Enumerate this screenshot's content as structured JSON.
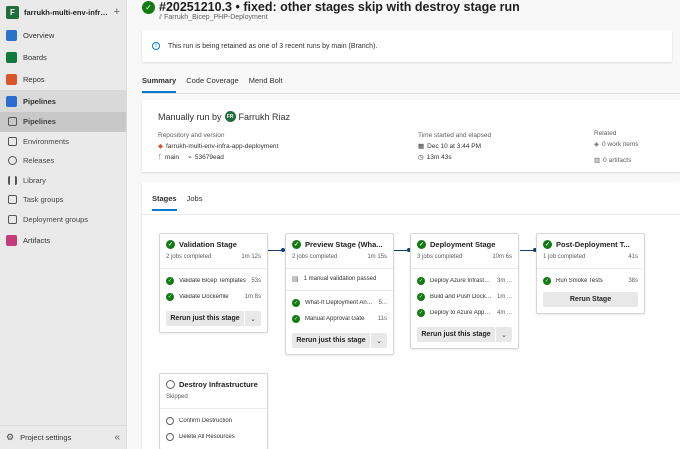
{
  "project": {
    "badge": "F",
    "name": "farrukh-multi-env-infra...",
    "plus": "+"
  },
  "nav": {
    "overview": "Overview",
    "boards": "Boards",
    "repos": "Repos",
    "pipelines_group": "Pipelines",
    "pipelines": "Pipelines",
    "environments": "Environments",
    "releases": "Releases",
    "library": "Library",
    "task_groups": "Task groups",
    "deployment_groups": "Deployment groups",
    "artifacts": "Artifacts",
    "project_settings": "Project settings",
    "collapse": "«"
  },
  "run": {
    "title": "#20251210.3 • fixed: other stages skip with destroy stage run",
    "pipeline": "Farrukh_Bicep_PHP-Deployment",
    "retention": "This run is being retained as one of 3 recent runs by main (Branch)."
  },
  "tabs": [
    "Summary",
    "Code Coverage",
    "Mend Bolt"
  ],
  "summary": {
    "trigger_prefix": "Manually run by",
    "user": "Farrukh Riaz",
    "user_initials": "FR",
    "repo_label": "Repository and version",
    "repo": "farrukh-multi-env-infra-app-deployment",
    "branch": "main",
    "commit": "53679ead",
    "time_label": "Time started and elapsed",
    "started": "Dec 10 at 3:44 PM",
    "elapsed": "13m 43s",
    "related_label": "Related",
    "work_items": "0 work items",
    "artifacts": "0 artifacts"
  },
  "stage_tabs": [
    "Stages",
    "Jobs"
  ],
  "stages": {
    "validation": {
      "name": "Validation Stage",
      "meta": "2 jobs completed",
      "time": "1m 12s",
      "jobs": [
        {
          "name": "Validate Bicep Templates",
          "time": "53s"
        },
        {
          "name": "Validate Dockerfile",
          "time": "1m 8s"
        }
      ],
      "button": "Rerun just this stage"
    },
    "preview": {
      "name": "Preview Stage (Wha...",
      "meta": "2 jobs completed",
      "time": "1m 15s",
      "manual": "1 manual validation passed",
      "jobs": [
        {
          "name": "What-If Deployment Analy...",
          "time": "5..."
        },
        {
          "name": "Manual Approval Gate",
          "time": "11s"
        }
      ],
      "button": "Rerun just this stage"
    },
    "deployment": {
      "name": "Deployment Stage",
      "meta": "3 jobs completed",
      "time": "10m 6s",
      "jobs": [
        {
          "name": "Deploy Azure Infrastru...",
          "time": "3m ..."
        },
        {
          "name": "Build and Push Docker...",
          "time": "1m ..."
        },
        {
          "name": "Deploy to Azure App S...",
          "time": "4m ..."
        }
      ],
      "button": "Rerun just this stage"
    },
    "post": {
      "name": "Post-Deployment T...",
      "meta": "1 job completed",
      "time": "41s",
      "jobs": [
        {
          "name": "Run Smoke Tests",
          "time": "38s"
        }
      ],
      "button": "Rerun Stage"
    },
    "destroy": {
      "name": "Destroy Infrastructure",
      "meta": "Skipped",
      "jobs": [
        {
          "name": "Confirm Destruction"
        },
        {
          "name": "Delete All Resources"
        }
      ]
    }
  },
  "colors": {
    "success": "#107c10",
    "accent": "#0078d4",
    "connector": "#0f3e75"
  },
  "icons": {
    "success": "✓",
    "info": "i",
    "chevron_down": "⌄"
  }
}
